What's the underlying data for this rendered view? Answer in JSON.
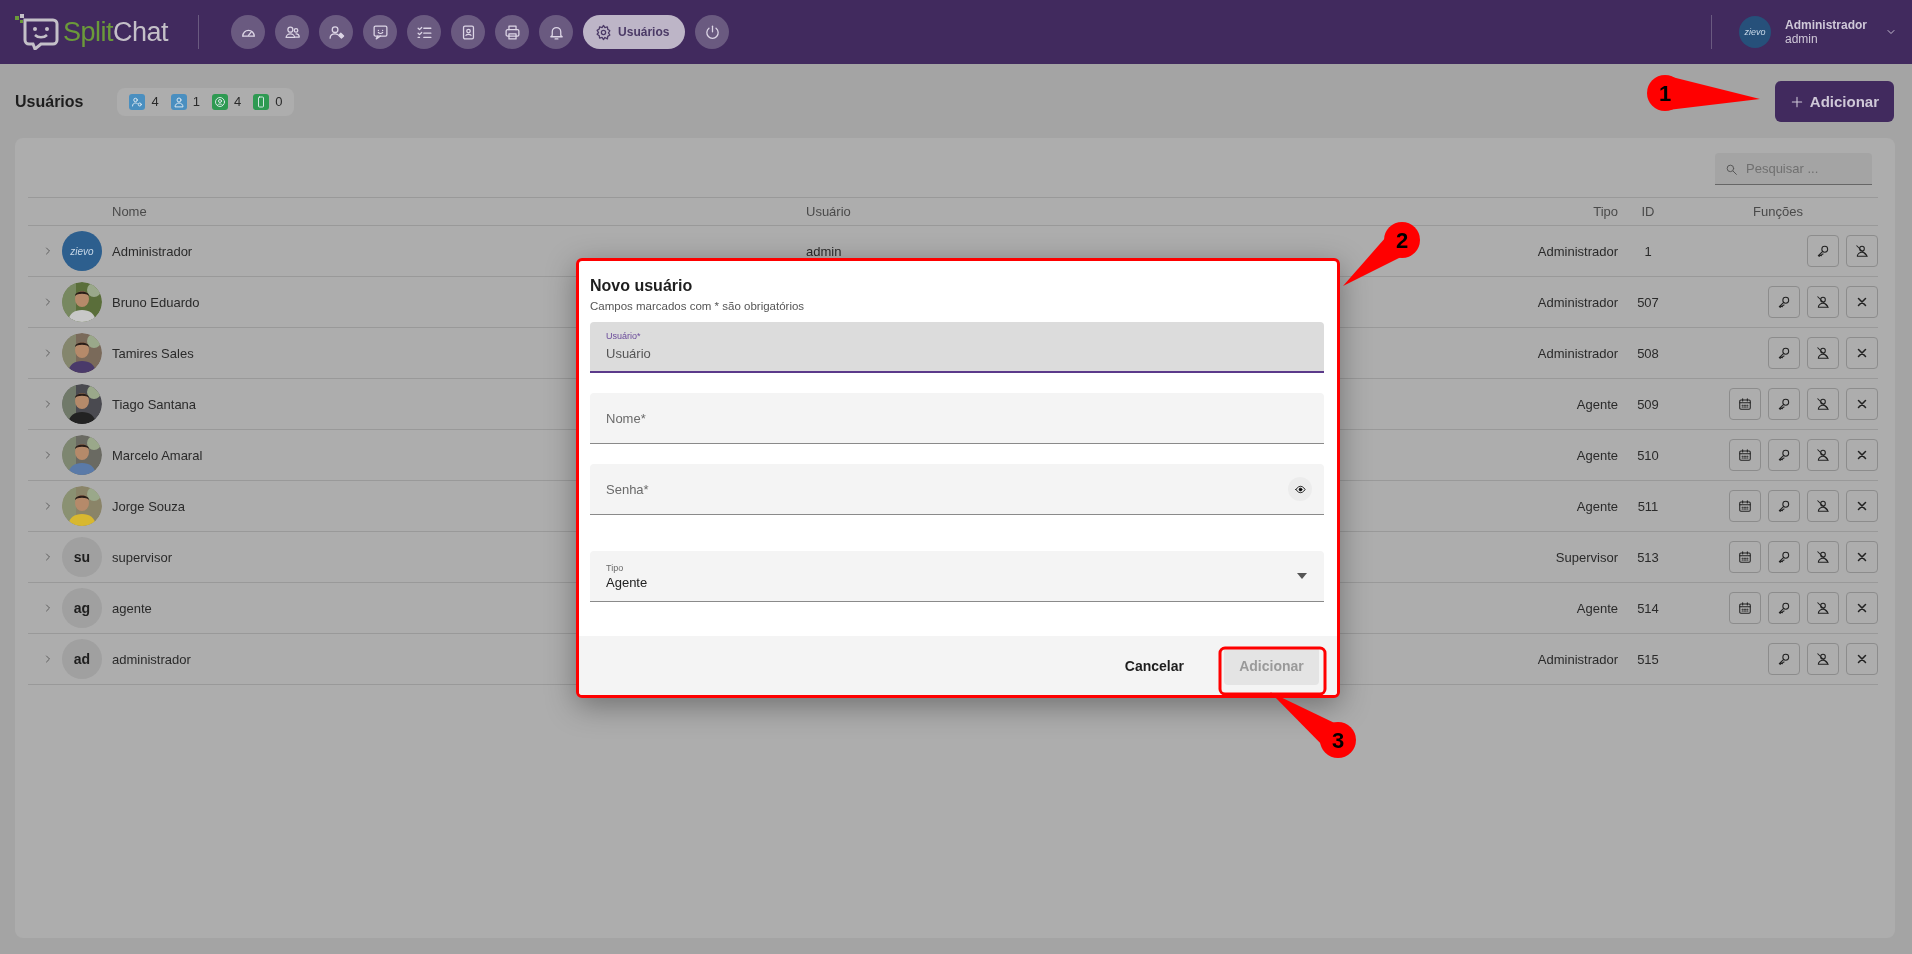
{
  "topbar": {
    "logo": {
      "first": "Split",
      "second": "Chat"
    },
    "nav": [
      {
        "kind": "gauge",
        "selected": false
      },
      {
        "kind": "users",
        "selected": false
      },
      {
        "kind": "user-tag",
        "selected": false
      },
      {
        "kind": "chat",
        "selected": false
      },
      {
        "kind": "checklist",
        "selected": false
      },
      {
        "kind": "contact",
        "selected": false
      },
      {
        "kind": "printer",
        "selected": false
      },
      {
        "kind": "bell",
        "selected": false
      },
      {
        "kind": "gear",
        "label": "Usuários",
        "selected": true
      },
      {
        "kind": "power",
        "selected": false
      }
    ],
    "user": {
      "avatar": "zievo",
      "name": "Administrador",
      "login": "admin"
    }
  },
  "page": {
    "title": "Usuários",
    "counts": [
      {
        "kind": "user-gear",
        "value": "4",
        "color": "#4a8fc0"
      },
      {
        "kind": "user",
        "value": "1",
        "color": "#4a8fc0"
      },
      {
        "kind": "user-circle",
        "value": "4",
        "color": "#2e9a52"
      },
      {
        "kind": "phone",
        "value": "0",
        "color": "#2e9a52"
      }
    ],
    "add_button": "Adicionar"
  },
  "table": {
    "search_placeholder": "Pesquisar ...",
    "columns": [
      "Nome",
      "Usuário",
      "Tipo",
      "ID",
      "Funções"
    ],
    "rows": [
      {
        "avatar": {
          "kind": "logo",
          "text": "zievo"
        },
        "name": "Administrador",
        "login": "admin",
        "type": "Administrador",
        "id": "1",
        "actions": [
          {
            "kind": "key"
          },
          {
            "kind": "block"
          }
        ]
      },
      {
        "avatar": {
          "kind": "picture"
        },
        "name": "Bruno Eduardo",
        "type": "Administrador",
        "id": "507",
        "actions": [
          {
            "kind": "key"
          },
          {
            "kind": "block"
          },
          {
            "kind": "delete"
          }
        ]
      },
      {
        "avatar": {
          "kind": "picture"
        },
        "name": "Tamires Sales",
        "type": "Administrador",
        "id": "508",
        "actions": [
          {
            "kind": "key"
          },
          {
            "kind": "block"
          },
          {
            "kind": "delete"
          }
        ]
      },
      {
        "avatar": {
          "kind": "picture"
        },
        "name": "Tiago Santana",
        "type": "Agente",
        "id": "509",
        "actions": [
          {
            "kind": "calendar"
          },
          {
            "kind": "key"
          },
          {
            "kind": "block"
          },
          {
            "kind": "delete"
          }
        ]
      },
      {
        "avatar": {
          "kind": "picture"
        },
        "name": "Marcelo Amaral",
        "type": "Agente",
        "id": "510",
        "actions": [
          {
            "kind": "calendar"
          },
          {
            "kind": "key"
          },
          {
            "kind": "block"
          },
          {
            "kind": "delete"
          }
        ]
      },
      {
        "avatar": {
          "kind": "picture"
        },
        "name": "Jorge Souza",
        "type": "Agente",
        "id": "511",
        "actions": [
          {
            "kind": "calendar"
          },
          {
            "kind": "key"
          },
          {
            "kind": "block"
          },
          {
            "kind": "delete"
          }
        ]
      },
      {
        "avatar": {
          "kind": "initials",
          "text": "su"
        },
        "name": "supervisor",
        "type": "Supervisor",
        "id": "513",
        "actions": [
          {
            "kind": "calendar"
          },
          {
            "kind": "key"
          },
          {
            "kind": "block"
          },
          {
            "kind": "delete"
          }
        ]
      },
      {
        "avatar": {
          "kind": "initials",
          "text": "ag"
        },
        "name": "agente",
        "type": "Agente",
        "id": "514",
        "actions": [
          {
            "kind": "calendar"
          },
          {
            "kind": "key"
          },
          {
            "kind": "block"
          },
          {
            "kind": "delete"
          }
        ]
      },
      {
        "avatar": {
          "kind": "initials",
          "text": "ad"
        },
        "name": "administrador",
        "type": "Administrador",
        "id": "515",
        "actions": [
          {
            "kind": "key"
          },
          {
            "kind": "block"
          },
          {
            "kind": "delete"
          }
        ]
      }
    ]
  },
  "dialog": {
    "title": "Novo usuário",
    "subtitle": "Campos marcados com * são obrigatórios",
    "fields": [
      {
        "kind": "text",
        "label": "Usuário*",
        "placeholder": "Usuário",
        "focused": true
      },
      {
        "kind": "text",
        "label": "Nome*",
        "focused": false
      },
      {
        "kind": "password",
        "label": "Senha*",
        "focused": false
      },
      {
        "kind": "select",
        "label": "Tipo",
        "value": "Agente",
        "focused": false
      }
    ],
    "cancel": "Cancelar",
    "submit": {
      "label": "Adicionar",
      "disabled": true
    }
  },
  "annotations": [
    {
      "label": "1"
    },
    {
      "label": "2",
      "frame": true
    },
    {
      "label": "3",
      "frame": true
    }
  ]
}
